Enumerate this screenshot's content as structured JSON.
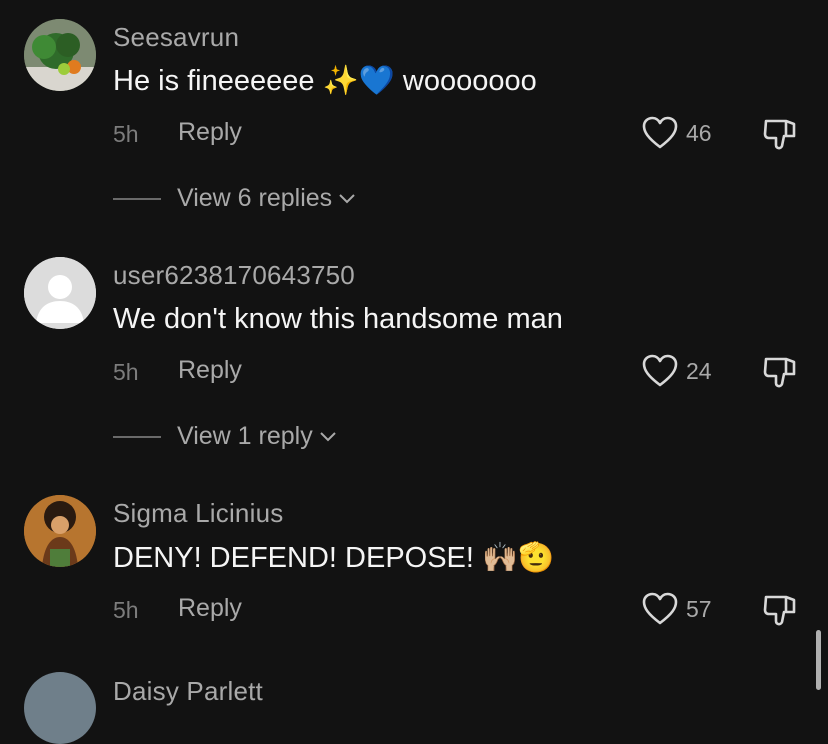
{
  "comments": [
    {
      "username": "Seesavrun",
      "text": "He is fineeeeee",
      "emoji_after_text": "✨💙",
      "text_tail": " wooooooo",
      "time": "5h",
      "reply_label": "Reply",
      "likes": "46",
      "view_replies": "View 6 replies",
      "avatar_icon": "plant-photo-avatar"
    },
    {
      "username": "user6238170643750",
      "text": "We don't know this handsome man",
      "time": "5h",
      "reply_label": "Reply",
      "likes": "24",
      "view_replies": "View 1 reply",
      "avatar_icon": "default-user-avatar"
    },
    {
      "username": "Sigma Licinius",
      "text": "DENY! DEFEND! DEPOSE!",
      "emoji_after_text": "🙌🏼🫡",
      "time": "5h",
      "reply_label": "Reply",
      "likes": "57",
      "avatar_icon": "anime-character-avatar"
    }
  ],
  "partial_next_username": "Daisy Parlett",
  "colors": {
    "background": "#121212",
    "text_primary": "#f5f5f5",
    "text_secondary": "#a9a9a9",
    "text_muted": "#7c7c7c"
  }
}
